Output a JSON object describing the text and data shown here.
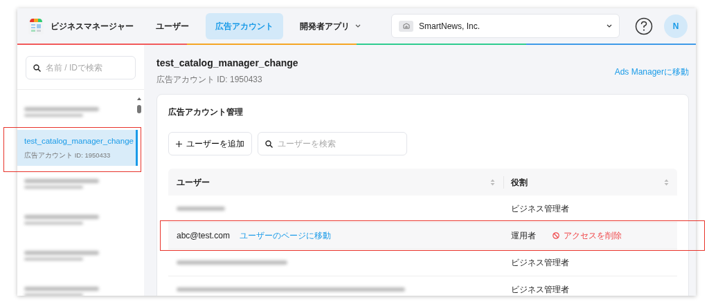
{
  "header": {
    "app_title": "ビジネスマネージャー",
    "nav": [
      {
        "label": "ユーザー",
        "selected": false,
        "has_menu": false
      },
      {
        "label": "広告アカウント",
        "selected": true,
        "has_menu": false
      },
      {
        "label": "開発者アプリ",
        "selected": false,
        "has_menu": true
      }
    ],
    "org_selector": {
      "label": "SmartNews, Inc."
    },
    "avatar": {
      "initial": "N"
    }
  },
  "sidebar": {
    "search": {
      "placeholder": "名前 / IDで検索"
    },
    "items": [
      {
        "blurred": true,
        "selected": false,
        "highlighted": false
      },
      {
        "blurred": false,
        "title": "test_catalog_manager_change",
        "subtitle": "広告アカウント ID: 1950433",
        "selected": true,
        "highlighted": true
      },
      {
        "blurred": true,
        "selected": false,
        "highlighted": false
      },
      {
        "blurred": true,
        "selected": false,
        "highlighted": false
      },
      {
        "blurred": true,
        "selected": false,
        "highlighted": false
      },
      {
        "blurred": true,
        "selected": false,
        "highlighted": false
      }
    ]
  },
  "main": {
    "title": "test_catalog_manager_change",
    "subtitle": "広告アカウント ID: 1950433",
    "link": "Ads Managerに移動",
    "card": {
      "title": "広告アカウント管理",
      "add_button": "ユーザーを追加",
      "search": {
        "placeholder": "ユーザーを検索"
      },
      "columns": [
        "ユーザー",
        "役割"
      ],
      "rows": [
        {
          "blurred": true,
          "role": "ビジネス管理者",
          "highlighted": false,
          "hovered": false
        },
        {
          "blurred": false,
          "user": "abc@test.com",
          "link": "ユーザーのページに移動",
          "role": "運用者",
          "action": "アクセスを削除",
          "highlighted": true,
          "hovered": true
        },
        {
          "blurred": true,
          "role": "ビジネス管理者",
          "highlighted": false,
          "hovered": false
        },
        {
          "blurred": true,
          "role": "ビジネス管理者",
          "highlighted": false,
          "hovered": false
        }
      ]
    }
  }
}
